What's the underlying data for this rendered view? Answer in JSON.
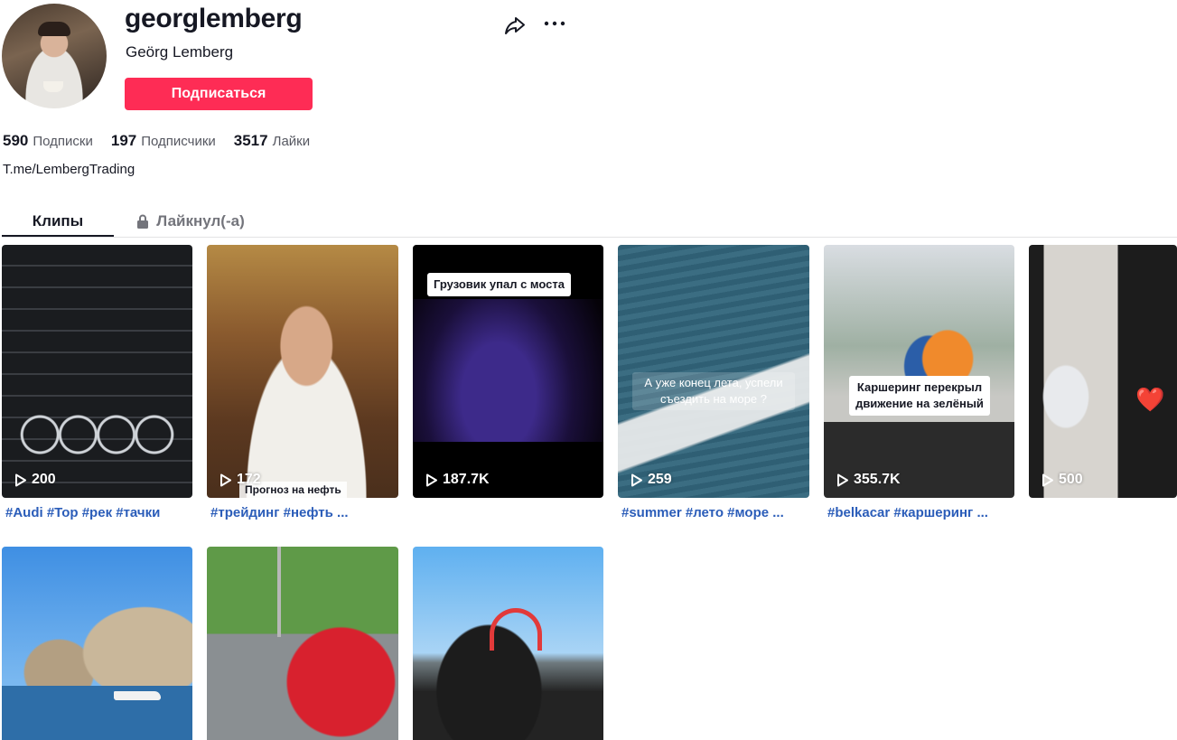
{
  "profile": {
    "username": "georglemberg",
    "nickname": "Geörg Lemberg",
    "follow_label": "Подписаться",
    "bio": "T.me/LembergTrading",
    "accent_color": "#fe2c55"
  },
  "stats": [
    {
      "value": "590",
      "label": "Подписки"
    },
    {
      "value": "197",
      "label": "Подписчики"
    },
    {
      "value": "3517",
      "label": "Лайки"
    }
  ],
  "tabs": {
    "clips": "Клипы",
    "liked": "Лайкнул(-а)"
  },
  "videos": [
    {
      "views": "200",
      "caption": "#Audi #Top #рек #тачки",
      "overlay": ""
    },
    {
      "views": "172",
      "caption": "#трейдинг #нефть ...",
      "overlay": "Прогноз на нефть"
    },
    {
      "views": "187.7K",
      "caption": "",
      "overlay": "Грузовик упал с моста"
    },
    {
      "views": "259",
      "caption": "#summer #лето #море ...",
      "overlay": "А уже конец лета, успели съездить на море ?"
    },
    {
      "views": "355.7K",
      "caption": "#belkacar #каршеринг ...",
      "overlay": "Каршеринг перекрыл движение на зелёный"
    },
    {
      "views": "500",
      "caption": "",
      "overlay": ""
    },
    {
      "views": "",
      "caption": "",
      "overlay": ""
    },
    {
      "views": "",
      "caption": "",
      "overlay": ""
    },
    {
      "views": "",
      "caption": "",
      "overlay": ""
    }
  ],
  "icons": {
    "share": "share-icon",
    "more": "more-icon",
    "lock": "lock-icon",
    "play": "play-icon"
  }
}
